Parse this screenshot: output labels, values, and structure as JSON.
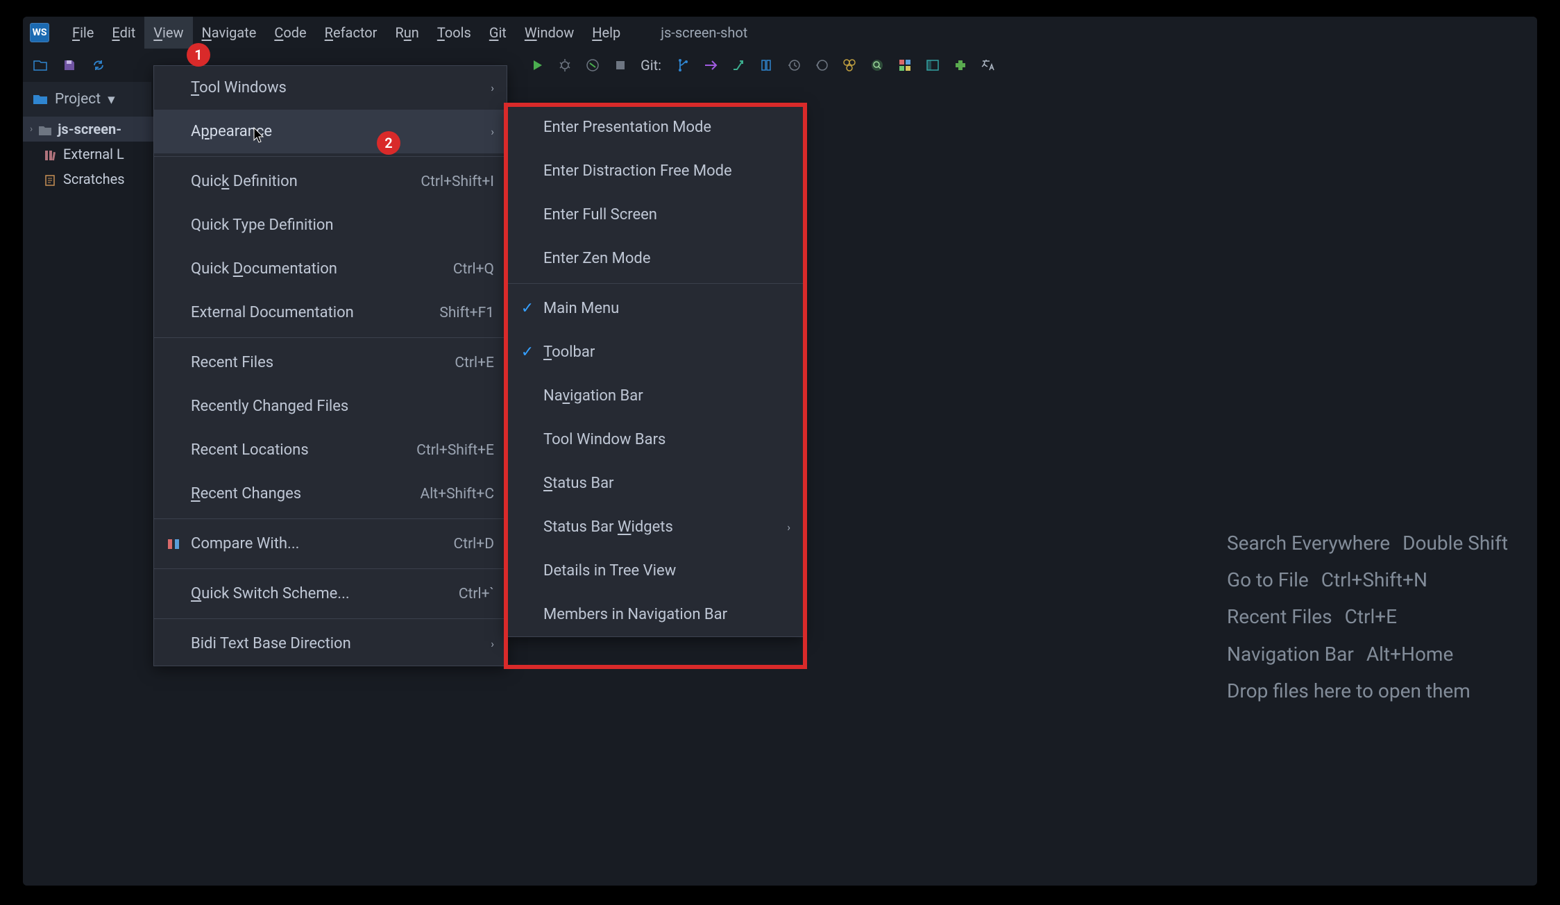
{
  "app_badge": "WS",
  "menubar": [
    "File",
    "Edit",
    "View",
    "Navigate",
    "Code",
    "Refactor",
    "Run",
    "Tools",
    "Git",
    "Window",
    "Help"
  ],
  "project_title": "js-screen-shot",
  "project_panel_label": "Project",
  "tree": {
    "root": "js-screen-",
    "ext_lib": "External L",
    "scratches": "Scratches"
  },
  "hints": [
    {
      "label": "Search Everywhere",
      "shortcut": "Double Shift"
    },
    {
      "label": "Go to File",
      "shortcut": "Ctrl+Shift+N"
    },
    {
      "label": "Recent Files",
      "shortcut": "Ctrl+E"
    },
    {
      "label": "Navigation Bar",
      "shortcut": "Alt+Home"
    },
    {
      "label": "Drop files here to open them",
      "shortcut": ""
    }
  ],
  "menu1": [
    {
      "label": "Tool Windows",
      "shortcut": "",
      "arrow": true,
      "sep": false
    },
    {
      "label": "Appearance",
      "shortcut": "",
      "arrow": true,
      "sep": true,
      "hovered": true
    },
    {
      "label": "Quick Definition",
      "shortcut": "Ctrl+Shift+I",
      "arrow": false,
      "sep": false
    },
    {
      "label": "Quick Type Definition",
      "shortcut": "",
      "arrow": false,
      "sep": false
    },
    {
      "label": "Quick Documentation",
      "shortcut": "Ctrl+Q",
      "arrow": false,
      "sep": false
    },
    {
      "label": "External Documentation",
      "shortcut": "Shift+F1",
      "arrow": false,
      "sep": true
    },
    {
      "label": "Recent Files",
      "shortcut": "Ctrl+E",
      "arrow": false,
      "sep": false
    },
    {
      "label": "Recently Changed Files",
      "shortcut": "",
      "arrow": false,
      "sep": false
    },
    {
      "label": "Recent Locations",
      "shortcut": "Ctrl+Shift+E",
      "arrow": false,
      "sep": false
    },
    {
      "label": "Recent Changes",
      "shortcut": "Alt+Shift+C",
      "arrow": false,
      "sep": true
    },
    {
      "label": "Compare With...",
      "shortcut": "Ctrl+D",
      "arrow": false,
      "sep": true,
      "icon": "compare"
    },
    {
      "label": "Quick Switch Scheme...",
      "shortcut": "Ctrl+`",
      "arrow": false,
      "sep": true
    },
    {
      "label": "Bidi Text Base Direction",
      "shortcut": "",
      "arrow": true,
      "sep": false
    }
  ],
  "menu2": [
    {
      "label": "Enter Presentation Mode",
      "checked": false,
      "arrow": false,
      "sep": false
    },
    {
      "label": "Enter Distraction Free Mode",
      "checked": false,
      "arrow": false,
      "sep": false
    },
    {
      "label": "Enter Full Screen",
      "checked": false,
      "arrow": false,
      "sep": false
    },
    {
      "label": "Enter Zen Mode",
      "checked": false,
      "arrow": false,
      "sep": true
    },
    {
      "label": "Main Menu",
      "checked": true,
      "arrow": false,
      "sep": false
    },
    {
      "label": "Toolbar",
      "checked": true,
      "arrow": false,
      "sep": false
    },
    {
      "label": "Navigation Bar",
      "checked": false,
      "arrow": false,
      "sep": false
    },
    {
      "label": "Tool Window Bars",
      "checked": false,
      "arrow": false,
      "sep": false
    },
    {
      "label": "Status Bar",
      "checked": false,
      "arrow": false,
      "sep": false
    },
    {
      "label": "Status Bar Widgets",
      "checked": false,
      "arrow": true,
      "sep": false
    },
    {
      "label": "Details in Tree View",
      "checked": false,
      "arrow": false,
      "sep": false
    },
    {
      "label": "Members in Navigation Bar",
      "checked": false,
      "arrow": false,
      "sep": false
    }
  ],
  "git_label": "Git:",
  "callouts": {
    "one": "1",
    "two": "2"
  }
}
